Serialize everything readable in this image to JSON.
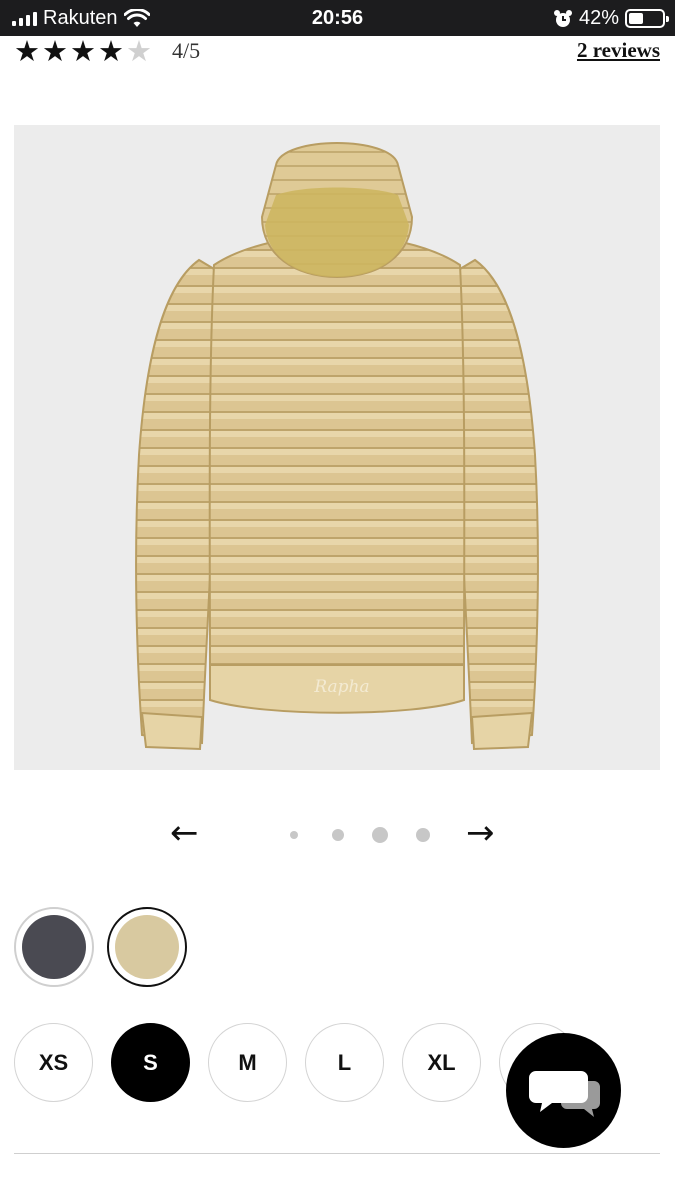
{
  "status_bar": {
    "carrier": "Rakuten",
    "time": "20:56",
    "battery_percent": "42%",
    "icons": [
      "signal-icon",
      "wifi-icon",
      "alarm-icon",
      "battery-icon"
    ]
  },
  "rating": {
    "stars_filled": 4,
    "stars_total": 5,
    "score_text": "4/5",
    "reviews_link": "2 reviews"
  },
  "product_image": {
    "description_icon": "jacket-image",
    "logo_text": "Rapha",
    "colors": {
      "background": "#ececec",
      "jacket": "#dcc592",
      "hood": "#cdb55e"
    }
  },
  "carousel": {
    "prev_icon": "←",
    "next_icon": "→",
    "slide_count": 4,
    "active_slide": 3
  },
  "colors": {
    "swatches": [
      {
        "name": "charcoal",
        "color": "#4a4a52",
        "selected": false
      },
      {
        "name": "sand",
        "color": "#d8c9a0",
        "selected": true
      }
    ]
  },
  "sizes": {
    "options": [
      "XS",
      "S",
      "M",
      "L",
      "XL"
    ],
    "selected": "S"
  },
  "chat": {
    "icon": "chat-bubbles-icon"
  }
}
